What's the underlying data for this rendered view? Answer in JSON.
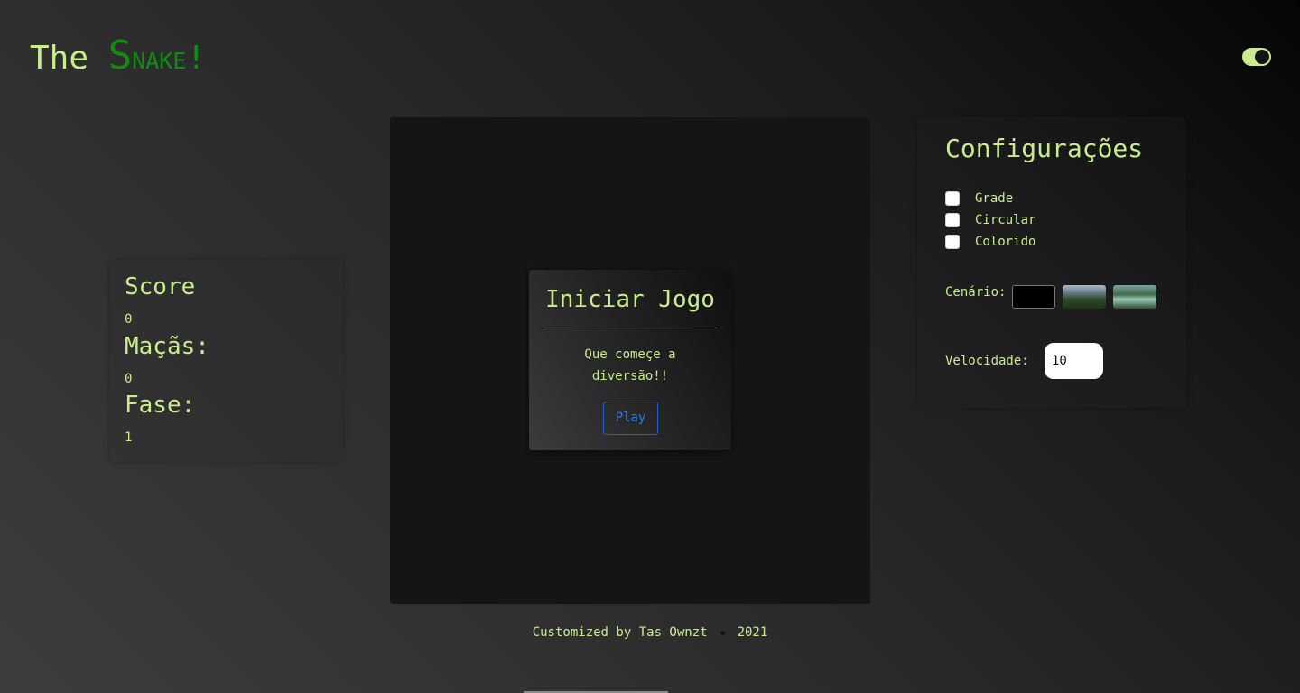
{
  "header": {
    "title_prefix": "The ",
    "title_snake_first": "S",
    "title_snake_rest": "nake!"
  },
  "theme_toggle": {
    "state": "on"
  },
  "score_panel": {
    "score_label": "Score",
    "score_value": "0",
    "apples_label": "Maçãs:",
    "apples_value": "0",
    "level_label": "Fase:",
    "level_value": "1"
  },
  "start_modal": {
    "title": "Iniciar Jogo",
    "message": "Que começe a diversão!!",
    "play_label": "Play"
  },
  "config": {
    "title": "Configurações",
    "options": [
      {
        "label": "Grade",
        "checked": false
      },
      {
        "label": "Circular",
        "checked": false
      },
      {
        "label": "Colorido",
        "checked": false
      }
    ],
    "scenario_label": "Cenário:",
    "speed_label": "Velocidade:",
    "speed_value": "10"
  },
  "footer": {
    "credit": "Customized by Tas Ownzt",
    "year": "2021"
  },
  "colors": {
    "accent": "#c9ec8f",
    "snake_green": "#138a13",
    "play_blue": "#2e7be6",
    "board": "#151515"
  }
}
